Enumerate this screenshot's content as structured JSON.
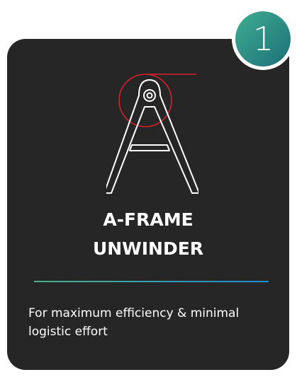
{
  "badge": {
    "number": "1"
  },
  "icon": {
    "name": "a-frame-unwinder-icon"
  },
  "title": {
    "line1": "A-FRAME",
    "line2": "UNWINDER"
  },
  "description": "For maximum efficiency & minimal logistic effort",
  "colors": {
    "card_background": "#262626",
    "accent_red": "#d8202b",
    "badge_teal": "#2a8f86",
    "divider_start": "#4fae89",
    "divider_end": "#1f8fd6"
  }
}
